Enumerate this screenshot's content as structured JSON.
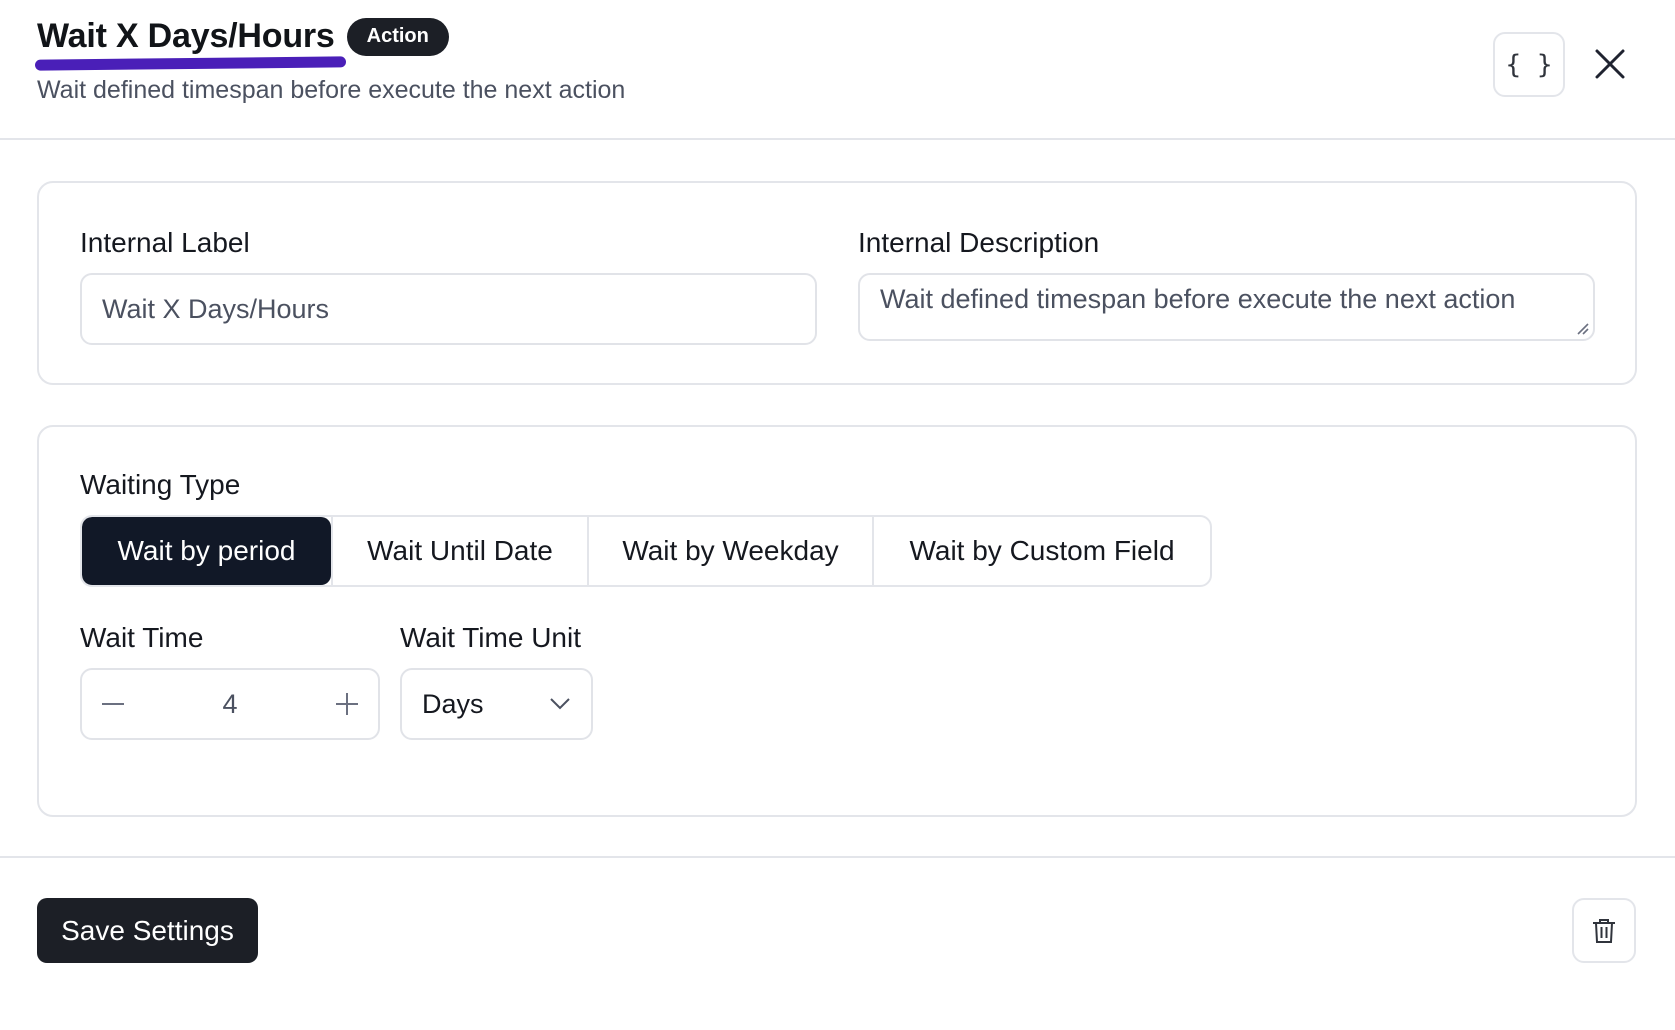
{
  "header": {
    "title": "Wait X Days/Hours",
    "badge": "Action",
    "subtitle": "Wait defined timespan before execute the next action",
    "json_button_label": "{ }",
    "accent_color": "#4a1fb8"
  },
  "general": {
    "internal_label": {
      "label": "Internal Label",
      "value": "Wait X Days/Hours"
    },
    "internal_description": {
      "label": "Internal Description",
      "value": "Wait defined timespan before execute the next action"
    }
  },
  "waiting": {
    "type_label": "Waiting Type",
    "types": [
      {
        "label": "Wait by period",
        "active": true
      },
      {
        "label": "Wait Until Date",
        "active": false
      },
      {
        "label": "Wait by Weekday",
        "active": false
      },
      {
        "label": "Wait by Custom Field",
        "active": false
      }
    ],
    "wait_time": {
      "label": "Wait Time",
      "value": "4"
    },
    "wait_time_unit": {
      "label": "Wait Time Unit",
      "selected": "Days"
    }
  },
  "footer": {
    "save_label": "Save Settings"
  },
  "icons": {
    "json": "code-braces-icon",
    "close": "close-icon",
    "minus": "minus-icon",
    "plus": "plus-icon",
    "chevron": "chevron-down-icon",
    "delete": "trash-icon"
  }
}
